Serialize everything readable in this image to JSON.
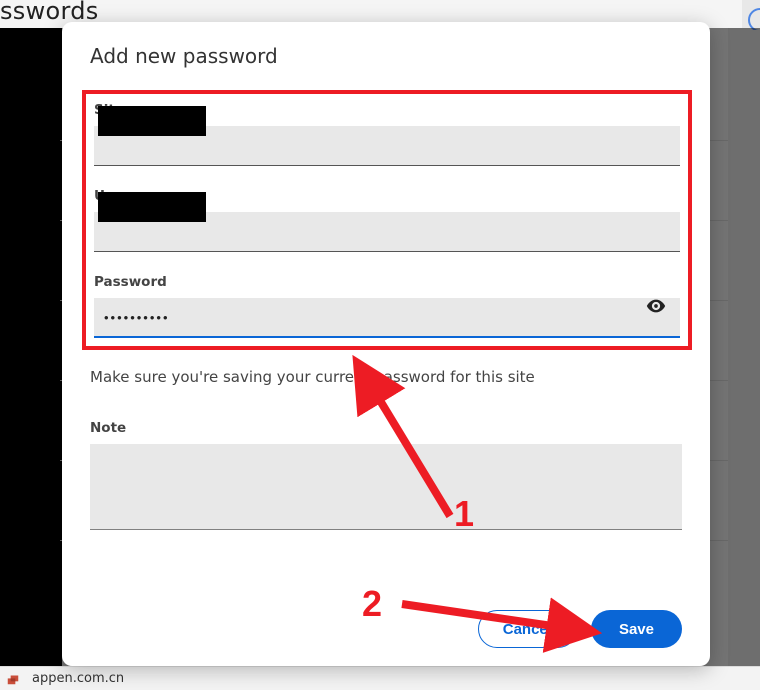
{
  "page": {
    "title_fragment": "sswords"
  },
  "footer": {
    "text": "appen.com.cn"
  },
  "dialog": {
    "title": "Add new password",
    "fields": {
      "site": {
        "label": "Site",
        "value": ""
      },
      "username": {
        "label": "Username",
        "value": ""
      },
      "password": {
        "label": "Password",
        "value": "••••••••••"
      }
    },
    "hint": "Make sure you're saving your current password for this site",
    "note": {
      "label": "Note",
      "value": ""
    },
    "buttons": {
      "cancel": "Cancel",
      "save": "Save"
    }
  },
  "annotations": {
    "step1": "1",
    "step2": "2",
    "highlight_color": "#ed1c24"
  }
}
